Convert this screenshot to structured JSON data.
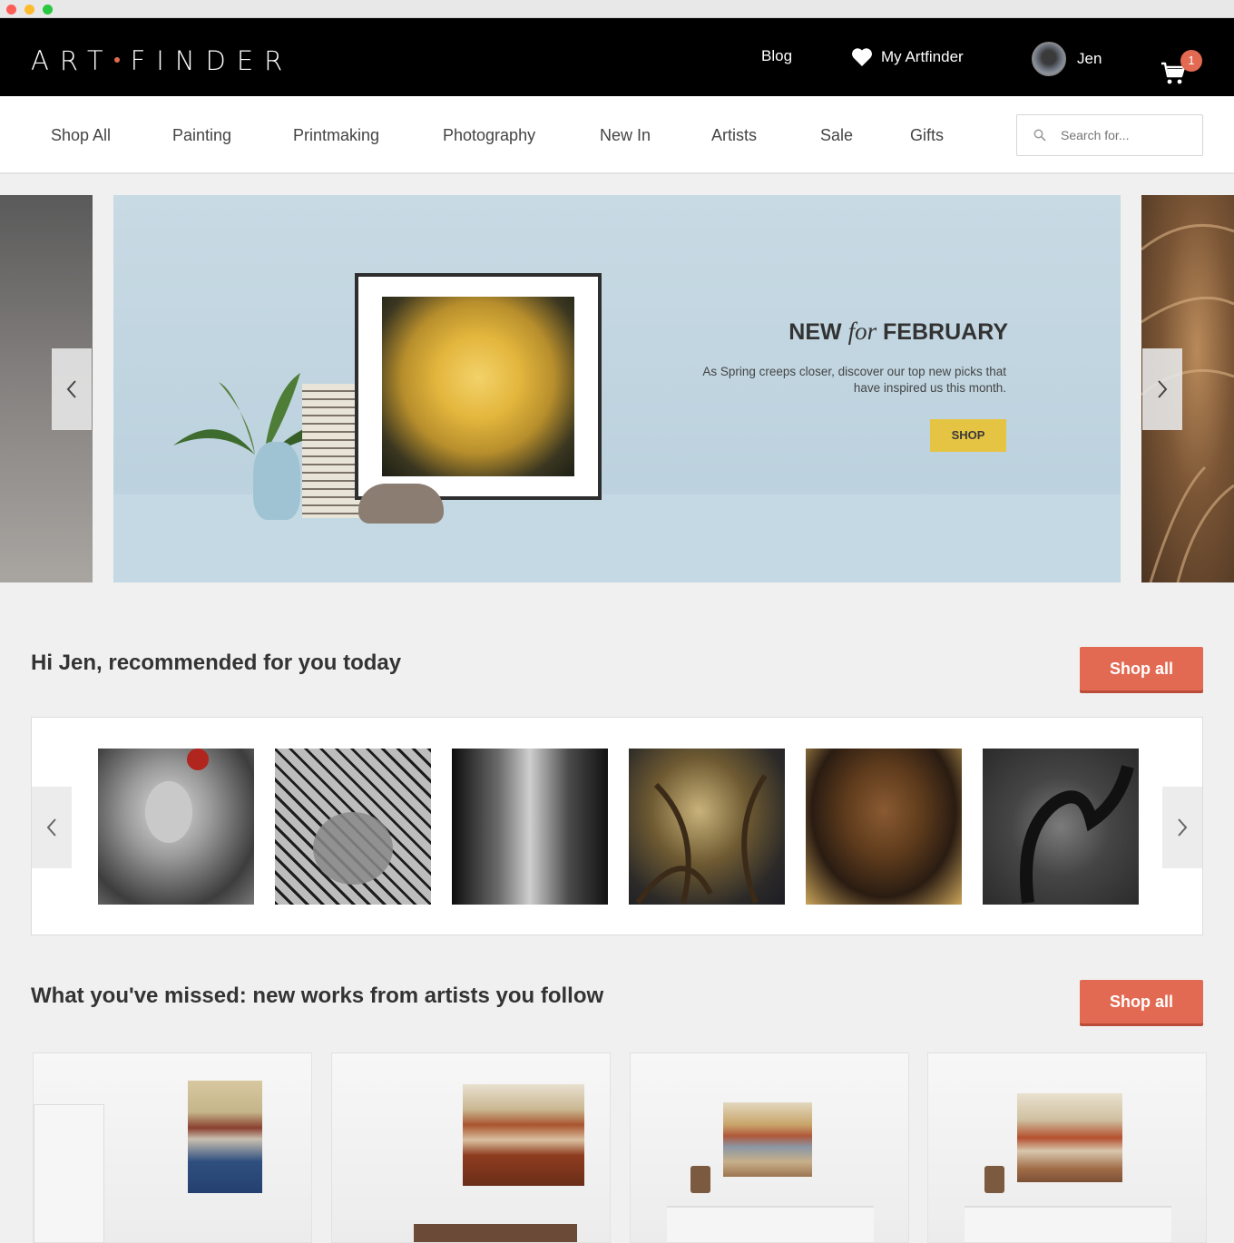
{
  "brand": {
    "logo_left": "ART",
    "logo_right": "FINDER"
  },
  "topnav": {
    "blog": "Blog",
    "my_artfinder": "My Artfinder",
    "user_name": "Jen",
    "cart_count": "1"
  },
  "nav": {
    "items": [
      "Shop All",
      "Painting",
      "Printmaking",
      "Photography",
      "New In",
      "Artists",
      "Sale",
      "Gifts"
    ],
    "search_placeholder": "Search for..."
  },
  "hero": {
    "title_new": "NEW",
    "title_for": "for",
    "title_month": "FEBRUARY",
    "subtitle": "As Spring creeps closer, discover our top new picks that have inspired us this month.",
    "button": "SHOP"
  },
  "recommended": {
    "title": "Hi Jen, recommended for you today",
    "button": "Shop all"
  },
  "following": {
    "title": "What you've missed: new works from artists you follow",
    "button": "Shop all"
  },
  "colors": {
    "accent": "#e36a52",
    "hero_button": "#e6c443",
    "topbar": "#000000"
  }
}
